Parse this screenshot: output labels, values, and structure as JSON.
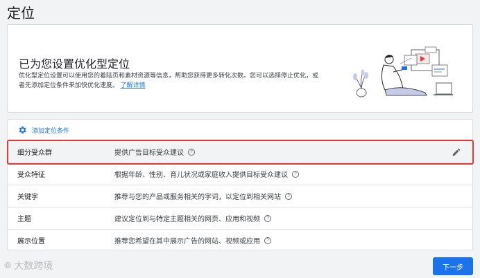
{
  "page": {
    "title": "定位"
  },
  "optimized": {
    "heading": "已为您设置优化型定位",
    "description_line1": "优化型定位设置可以使用您的着陆页和素材资源等信息，帮助您获得更多转化次数。您可以选择停止优化，或",
    "description_line2": "者先添加定位条件来加快优化速度。",
    "learn_more": "了解详情"
  },
  "targeting": {
    "add_label": "添加定位条件",
    "rows": [
      {
        "name": "细分受众群",
        "desc": "提供广告目标受众建议"
      },
      {
        "name": "受众特征",
        "desc": "根据年龄、性别、育儿状况或家庭收入提供目标受众建议"
      },
      {
        "name": "关键字",
        "desc": "推荐与您的产品或服务相关的字词，以定位到相关网站"
      },
      {
        "name": "主题",
        "desc": "建议定位到与特定主题相关的网页、应用和视频"
      },
      {
        "name": "展示位置",
        "desc": "推荐您希望在其中展示广告的网站、视频或应用"
      }
    ],
    "help_glyph": "?"
  },
  "footer": {
    "watermark": "大数跨境",
    "next_label": "下一步"
  },
  "colors": {
    "accent": "#1a73e8",
    "highlight": "#e53935"
  }
}
